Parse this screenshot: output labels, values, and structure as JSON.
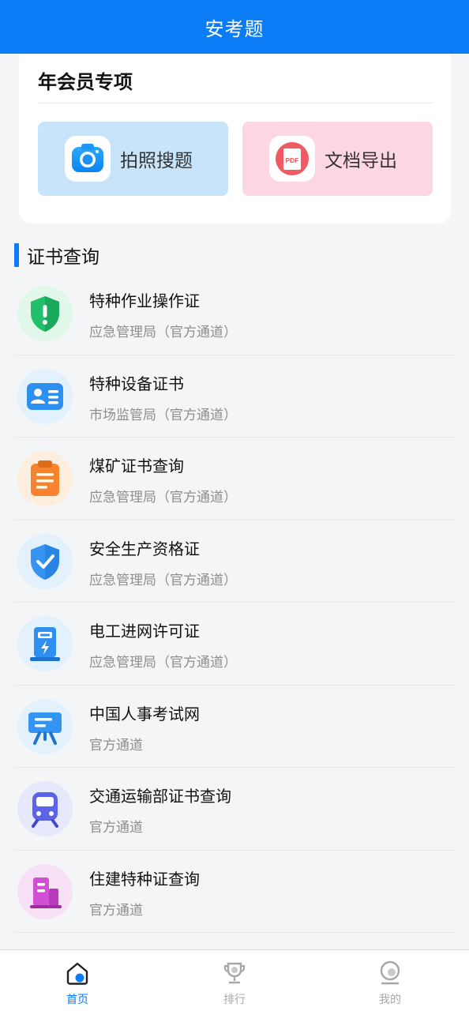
{
  "header": {
    "title": "安考题"
  },
  "vip": {
    "title": "年会员专项",
    "photo_search": "拍照搜题",
    "doc_export": "文档导出",
    "pdf_badge": "PDF"
  },
  "certs": {
    "section_title": "证书查询",
    "items": [
      {
        "title": "特种作业操作证",
        "subtitle": "应急管理局（官方通道）",
        "icon": "shield-alert-icon"
      },
      {
        "title": "特种设备证书",
        "subtitle": "市场监管局（官方通道）",
        "icon": "id-card-icon"
      },
      {
        "title": "煤矿证书查询",
        "subtitle": "应急管理局（官方通道）",
        "icon": "clipboard-icon"
      },
      {
        "title": "安全生产资格证",
        "subtitle": "应急管理局（官方通道）",
        "icon": "shield-check-icon"
      },
      {
        "title": "电工进网许可证",
        "subtitle": "应急管理局（官方通道）",
        "icon": "power-station-icon"
      },
      {
        "title": "中国人事考试网",
        "subtitle": "官方通道",
        "icon": "presentation-board-icon"
      },
      {
        "title": "交通运输部证书查询",
        "subtitle": "官方通道",
        "icon": "train-icon"
      },
      {
        "title": "住建特种证查询",
        "subtitle": "官方通道",
        "icon": "building-icon"
      }
    ]
  },
  "tabs": [
    {
      "label": "首页",
      "icon": "home-icon",
      "active": true
    },
    {
      "label": "排行",
      "icon": "trophy-icon",
      "active": false
    },
    {
      "label": "我的",
      "icon": "user-icon",
      "active": false
    }
  ],
  "colors": {
    "primary": "#0a7cf6",
    "background": "#f4f5f7"
  }
}
